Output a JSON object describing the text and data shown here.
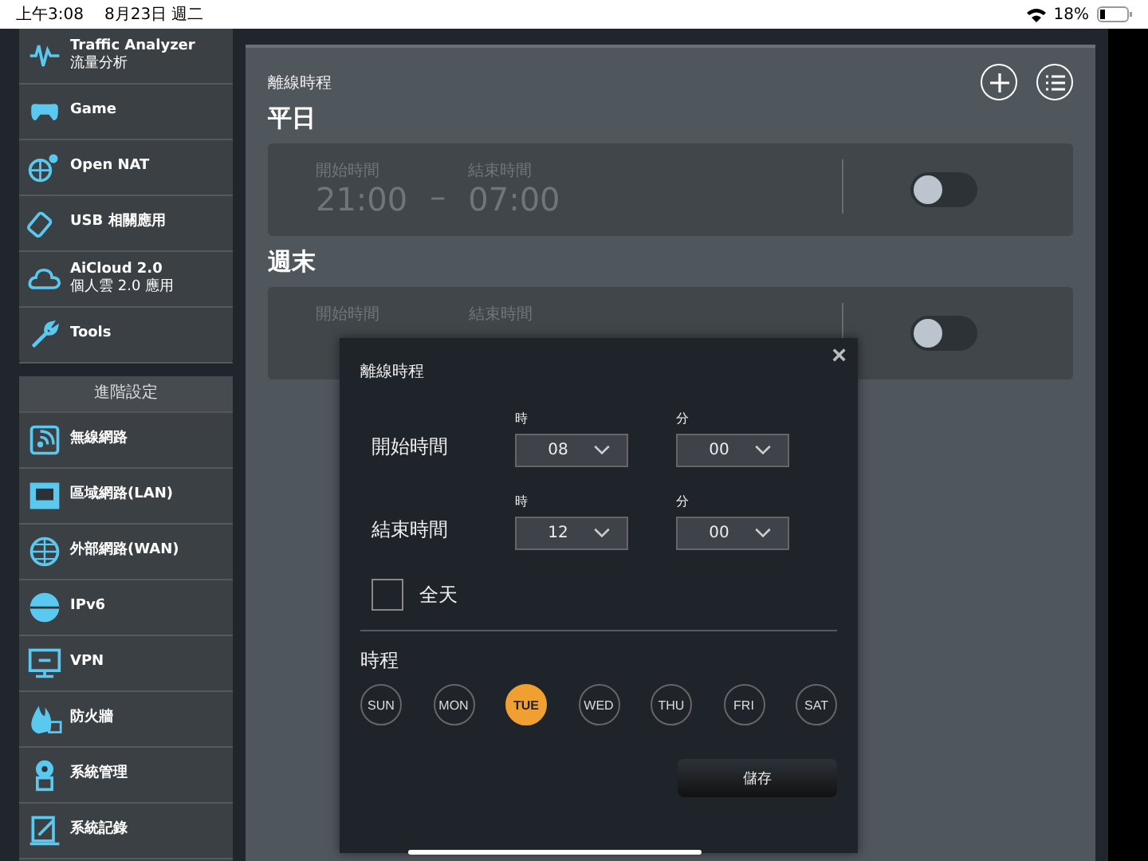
{
  "status_bar": {
    "time": "上午3:08",
    "date": "8月23日 週二",
    "battery": "18%"
  },
  "sidebar": {
    "general_items": [
      {
        "label": "Traffic Analyzer",
        "sublabel": "流量分析"
      },
      {
        "label": "Game"
      },
      {
        "label": "Open NAT"
      },
      {
        "label": "USB 相關應用"
      },
      {
        "label": "AiCloud 2.0",
        "sublabel": "個人雲 2.0 應用"
      },
      {
        "label": "Tools"
      }
    ],
    "advanced_header": "進階設定",
    "advanced_items": [
      {
        "label": "無線網路"
      },
      {
        "label": "區域網路(LAN)"
      },
      {
        "label": "外部網路(WAN)"
      },
      {
        "label": "IPv6"
      },
      {
        "label": "VPN"
      },
      {
        "label": "防火牆"
      },
      {
        "label": "系統管理"
      },
      {
        "label": "系統記錄"
      }
    ]
  },
  "main": {
    "title": "離線時程",
    "schedules": [
      {
        "heading": "平日",
        "start_label": "開始時間",
        "start_value": "21:00",
        "dash": "–",
        "end_label": "結束時間",
        "end_value": "07:00",
        "on": false
      },
      {
        "heading": "週末",
        "start_label": "開始時間",
        "end_label": "結束時間",
        "on": false
      }
    ]
  },
  "dialog": {
    "title": "離線時程",
    "close": "×",
    "rows": [
      {
        "label": "開始時間",
        "hour_label": "時",
        "hour": "08",
        "minute_label": "分",
        "minute": "00"
      },
      {
        "label": "結束時間",
        "hour_label": "時",
        "hour": "12",
        "minute_label": "分",
        "minute": "00"
      }
    ],
    "all_day": {
      "label": "全天",
      "checked": false
    },
    "schedule_label": "時程",
    "days": [
      {
        "label": "SUN",
        "selected": false
      },
      {
        "label": "MON",
        "selected": false
      },
      {
        "label": "TUE",
        "selected": true
      },
      {
        "label": "WED",
        "selected": false
      },
      {
        "label": "THU",
        "selected": false
      },
      {
        "label": "FRI",
        "selected": false
      },
      {
        "label": "SAT",
        "selected": false
      }
    ],
    "save": "儲存"
  }
}
